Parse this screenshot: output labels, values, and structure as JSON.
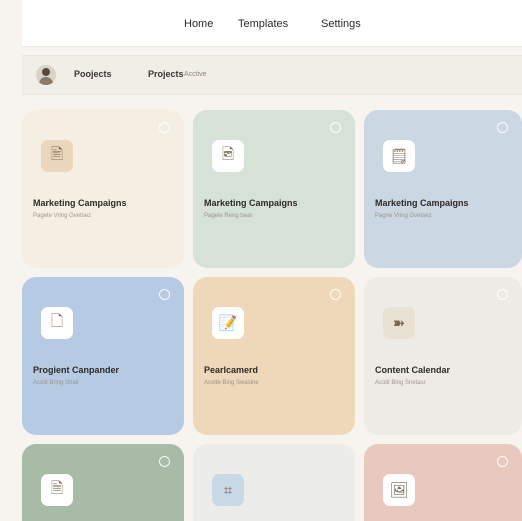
{
  "nav": {
    "items": [
      "Home",
      "Templates",
      "Settings"
    ]
  },
  "breadcrumb": {
    "items": [
      "Poojects",
      "Projects",
      "Acctive"
    ]
  },
  "cards": [
    {
      "title": "Marketing Campaigns",
      "subtitle": "Pagete Vring Gvetsez",
      "color": "#f5efe3",
      "icon_bg": "#ead7bb",
      "icon": "document-icon",
      "glyph": "🖹"
    },
    {
      "title": "Marketing Campaigns",
      "subtitle": "Pagele Reng bear",
      "color": "#d6e2d8",
      "icon_bg": "#ffffff",
      "icon": "chart-doc-icon",
      "glyph": "🖻"
    },
    {
      "title": "Marketing Campaigns",
      "subtitle": "Pagne Vring Gvetsez",
      "color": "#cbd7e3",
      "icon_bg": "#ffffff",
      "icon": "list-doc-icon",
      "glyph": "🗒"
    },
    {
      "title": "Progient Canpander",
      "subtitle": "Acolit Bring Shair",
      "color": "#b6cbe3",
      "icon_bg": "#ffffff",
      "icon": "note-icon",
      "glyph": "🗋"
    },
    {
      "title": "Pearlcamerd",
      "subtitle": "Acolte Bing Swasine",
      "color": "#eed8b9",
      "icon_bg": "#ffffff",
      "icon": "edit-doc-icon",
      "glyph": "📝"
    },
    {
      "title": "Content Calendar",
      "subtitle": "Acolit Bing Snetasr",
      "color": "#eeebe6",
      "icon_bg": "#e9e1d2",
      "icon": "send-icon",
      "glyph": "➽"
    },
    {
      "title": "",
      "subtitle": "",
      "color": "#a7bba6",
      "icon_bg": "#ffffff",
      "icon": "file-icon",
      "glyph": "🗎"
    },
    {
      "title": "",
      "subtitle": "",
      "color": "#ecece9",
      "icon_bg": "#c9d8e6",
      "icon": "grid-icon",
      "glyph": "⌗"
    },
    {
      "title": "",
      "subtitle": "",
      "color": "#e9c9bd",
      "icon_bg": "#ffffff",
      "icon": "gallery-icon",
      "glyph": "🖼"
    }
  ]
}
